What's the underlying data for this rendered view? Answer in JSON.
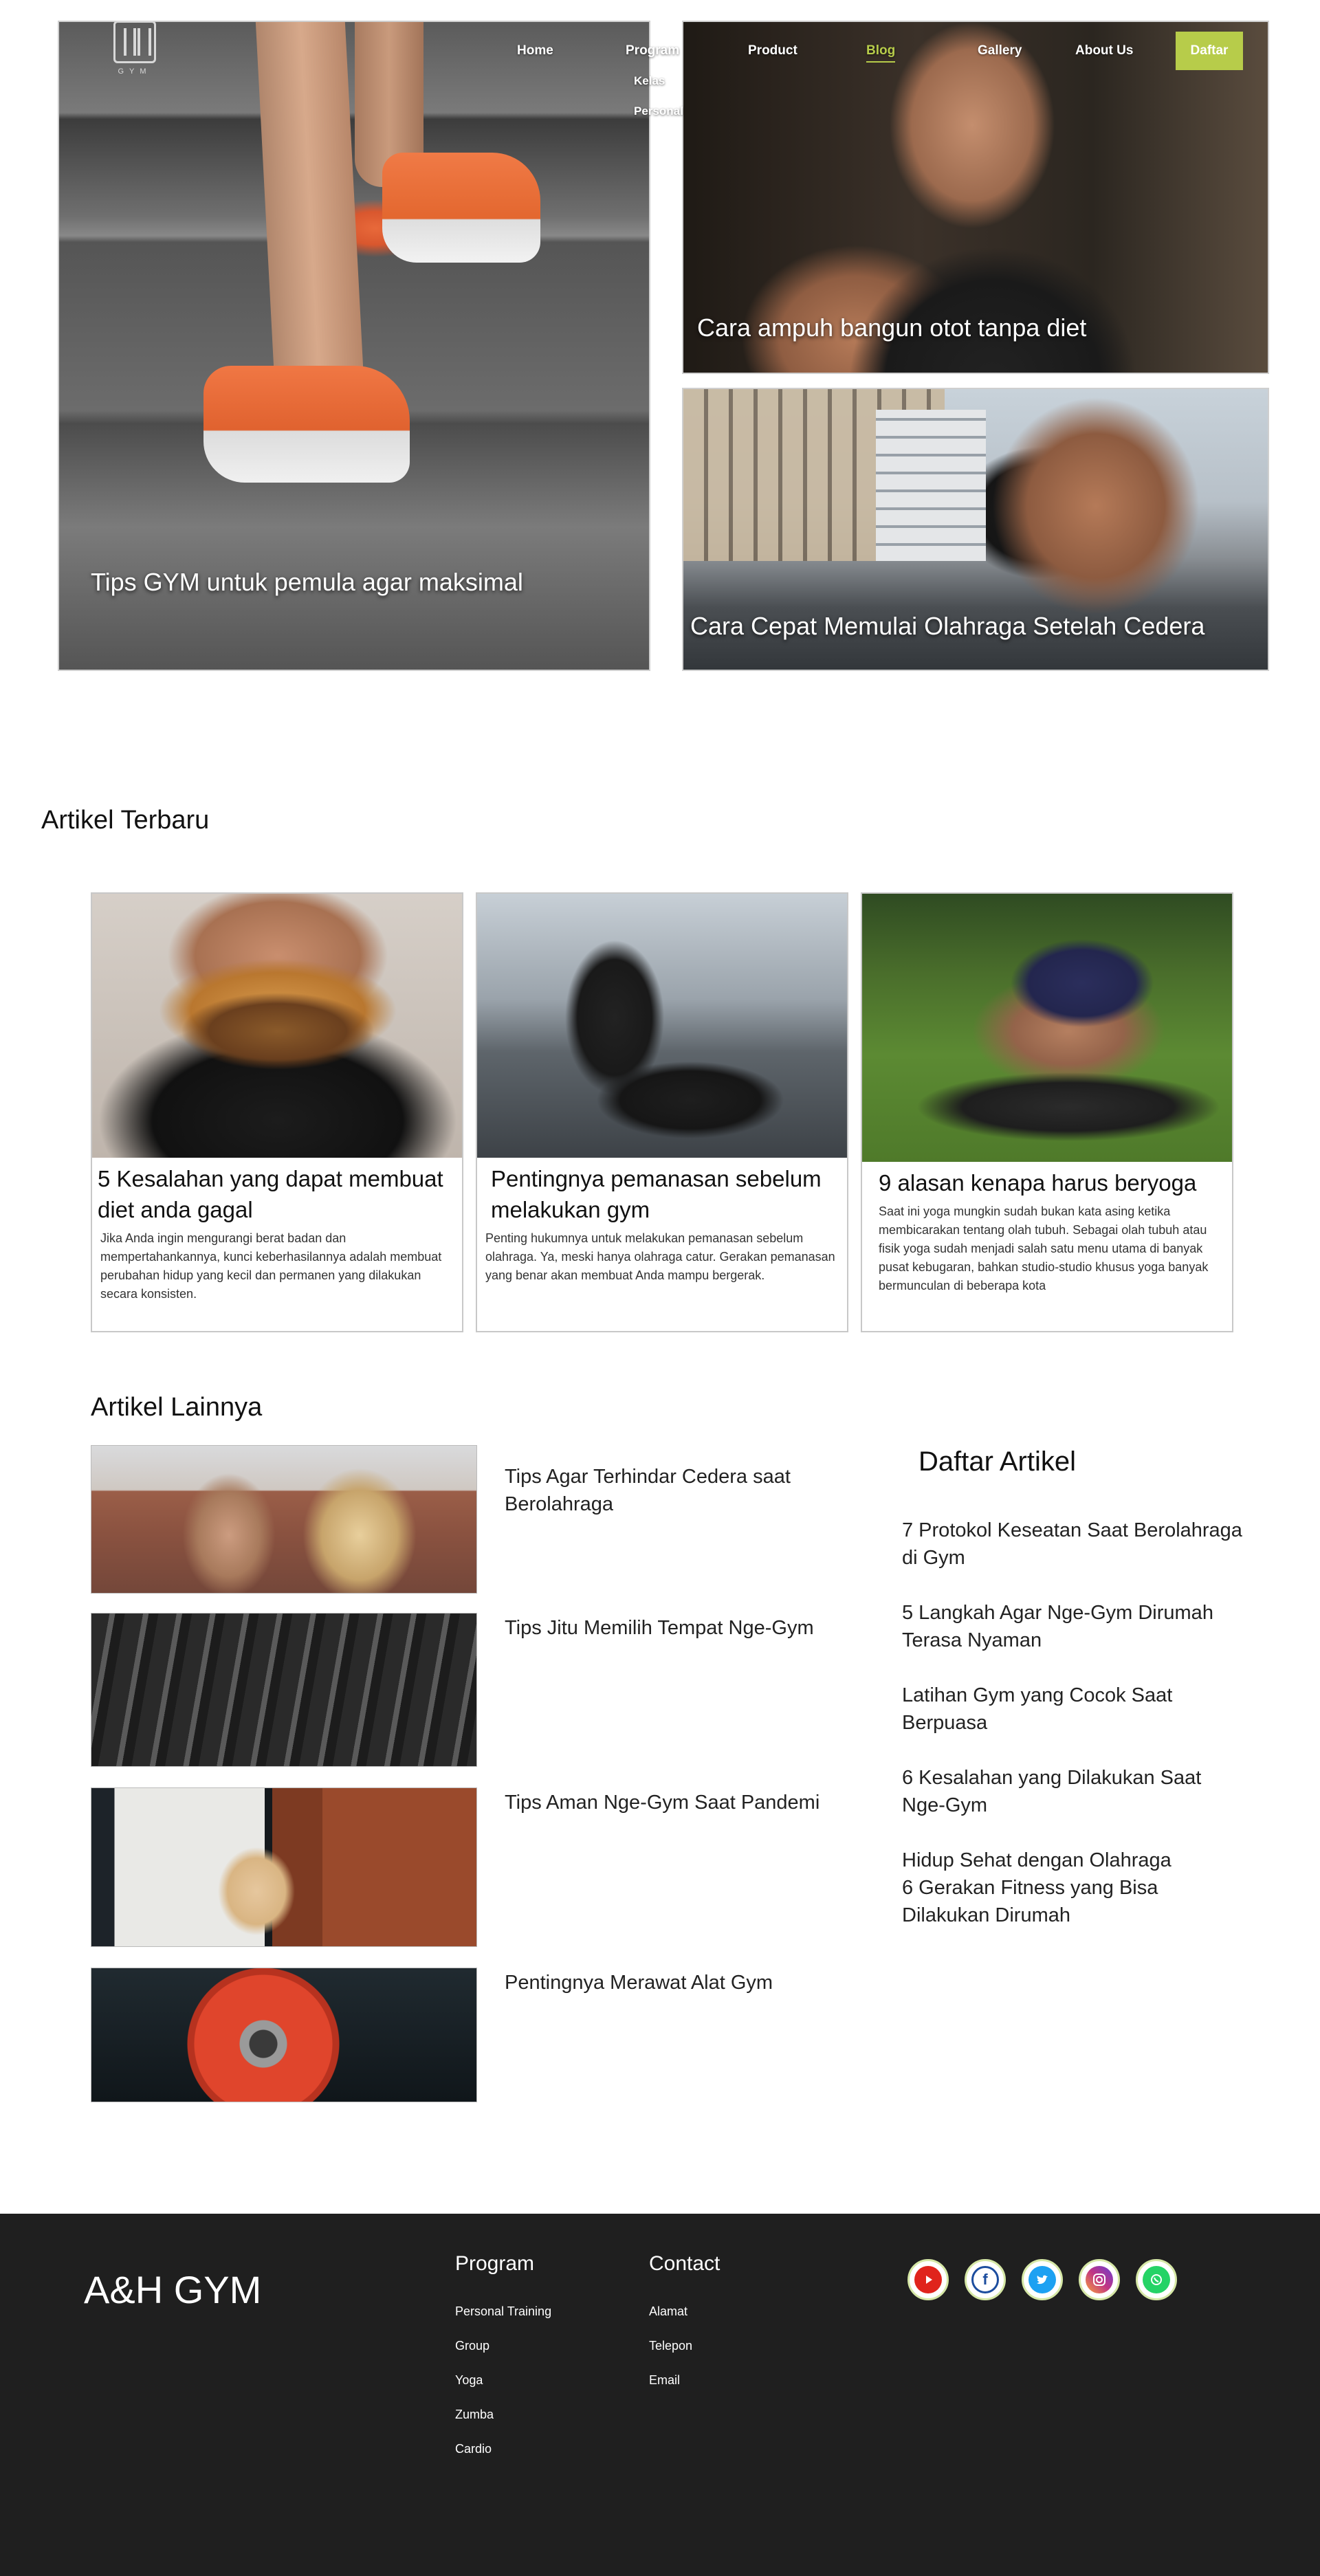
{
  "nav": {
    "logo_text": "GYM",
    "items": [
      {
        "label": "Home"
      },
      {
        "label": "Program"
      },
      {
        "label": "Product"
      },
      {
        "label": "Blog"
      },
      {
        "label": "Gallery"
      },
      {
        "label": "About Us"
      }
    ],
    "program_submenu": [
      "Kelas",
      "Personal"
    ],
    "cta_label": "Daftar",
    "accent_color": "#b7cc4a"
  },
  "hero": {
    "main_caption": "Tips GYM untuk pemula agar maksimal",
    "side_top_caption": "Cara ampuh bangun otot tanpa diet",
    "side_bottom_caption": "Cara Cepat Memulai Olahraga Setelah Cedera"
  },
  "terbaru": {
    "heading": "Artikel Terbaru",
    "cards": [
      {
        "title": "5 Kesalahan yang dapat membuat diet anda gagal",
        "desc": "Jika Anda ingin mengurangi berat badan dan mempertahankannya, kunci keberhasilannya adalah membuat perubahan hidup yang kecil dan permanen yang dilakukan secara konsisten."
      },
      {
        "title": "Pentingnya pemanasan sebelum melakukan gym",
        "desc": "Penting hukumnya untuk melakukan pemanasan sebelum olahraga. Ya, meski hanya olahraga catur. Gerakan pemanasan yang benar akan membuat Anda mampu bergerak."
      },
      {
        "title": "9 alasan kenapa harus beryoga",
        "desc": "Saat ini yoga mungkin sudah bukan kata asing ketika membicarakan tentang olah tubuh. Sebagai olah tubuh atau fisik yoga sudah menjadi salah satu menu utama di banyak pusat kebugaran, bahkan studio-studio khusus yoga banyak bermunculan di beberapa kota"
      }
    ]
  },
  "lainnya": {
    "heading": "Artikel Lainnya",
    "items": [
      {
        "title": "Tips Agar Terhindar Cedera saat Berolahraga"
      },
      {
        "title": "Tips Jitu Memilih Tempat Nge-Gym"
      },
      {
        "title": "Tips Aman Nge-Gym Saat Pandemi"
      },
      {
        "title": "Pentingnya Merawat Alat Gym"
      }
    ]
  },
  "daftar": {
    "heading": "Daftar Artikel",
    "items": [
      "7 Protokol Keseatan Saat Berolahraga di Gym",
      "5 Langkah Agar Nge-Gym Dirumah Terasa Nyaman",
      "Latihan Gym yang Cocok Saat Berpuasa",
      "6 Kesalahan yang Dilakukan Saat Nge-Gym",
      "Hidup Sehat dengan Olahraga",
      "6 Gerakan Fitness yang Bisa Dilakukan Dirumah"
    ]
  },
  "footer": {
    "brand": "A&H GYM",
    "program_heading": "Program",
    "program_links": [
      "Personal Training",
      "Group",
      "Yoga",
      "Zumba",
      "Cardio"
    ],
    "contact_heading": "Contact",
    "contact_links": [
      "Alamat",
      "Telepon",
      "Email"
    ],
    "social": [
      {
        "icon": "youtube-icon",
        "color": "#e0241c"
      },
      {
        "icon": "facebook-icon",
        "color": "#1c4d9e"
      },
      {
        "icon": "twitter-icon",
        "color": "#1da1f2"
      },
      {
        "icon": "instagram-icon",
        "color": "#c13584"
      },
      {
        "icon": "whatsapp-icon",
        "color": "#25d366"
      }
    ],
    "background": "#1f1f1f"
  }
}
